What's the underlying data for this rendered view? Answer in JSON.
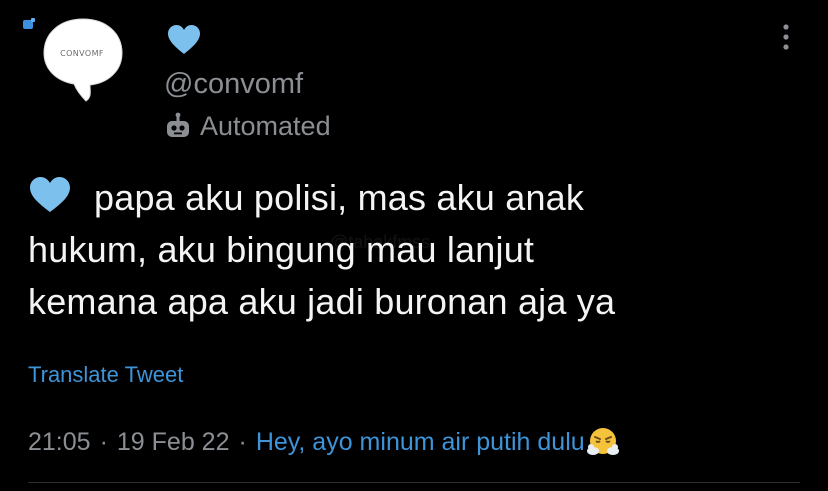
{
  "colors": {
    "background": "#000000",
    "text": "#f4f4f4",
    "muted": "#8b8f93",
    "link": "#3d94d8",
    "heart": "#7cc0ee"
  },
  "tweet": {
    "avatar_label": "CONVOMF",
    "handle": "@convomf",
    "automated_label": "Automated",
    "body_lines": [
      "papa aku polisi, mas aku anak",
      "hukum, aku bingung mau lanjut",
      "kemana apa aku jadi buronan aja ya"
    ],
    "watermark": "@tahakfmss",
    "translate_label": "Translate Tweet",
    "time": "21:05",
    "date": "19 Feb 22",
    "separator": "·",
    "source": "Hey, ayo minum air putih dulu",
    "icons": {
      "corner": "notification-icon",
      "name_badge": "blue-heart-icon",
      "automated": "robot-icon",
      "more": "more-options-icon",
      "body_emoji": "blue-heart-icon",
      "source_emoji": "steaming-face-icon"
    }
  }
}
